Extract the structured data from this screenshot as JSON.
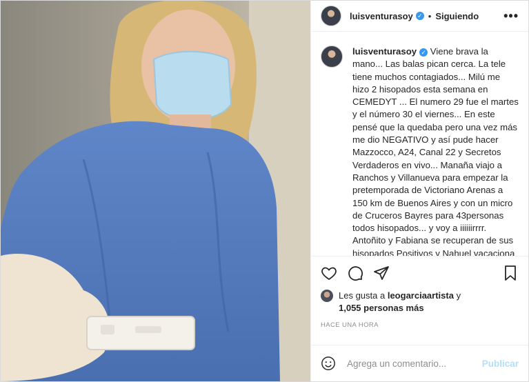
{
  "post": {
    "username": "luisventurasoy",
    "separator": "•",
    "follow_label": "Siguiendo",
    "more_label": "•••",
    "caption": "Viene brava la mano... Las balas pican cerca. La tele tiene muchos contagiados... Milú me hizo 2 hisopados esta semana en CEMEDYT ... El numero 29 fue el martes y el número 30 el viernes... En este pensé que la quedaba pero una vez más me dio NEGATIVO y así pude hacer Mazzocco, A24, Canal 22 y Secretos Verdaderos en vivo... Manaña viajo a Ranchos y Villanueva para empezar la pretemporada de Victoriano Arenas a 150 km de Buenos Aires y con un micro de Cruceros Bayres para 43personas todos hisopados... y voy a iiiiiirrrr. Antoñito y Fabiana se recuperan de sus hisopados Positivos y Nahuel vacaciona con su familia en Los Titanes. Tomo"
  },
  "likes": {
    "prefix": "Les gusta a",
    "liker": "leogarciaartista",
    "connector": "y",
    "others": "1,055 personas más"
  },
  "timestamp": "HACE UNA HORA",
  "comment": {
    "placeholder": "Agrega un comentario...",
    "publish_label": "Publicar"
  },
  "icons": {
    "heart": "heart-icon",
    "comment": "comment-icon",
    "share": "paper-plane-icon",
    "save": "bookmark-icon",
    "emoji": "emoji-icon",
    "verified": "verified-badge-icon"
  },
  "colors": {
    "verified": "#3897f0",
    "publish_disabled": "#b2dffc",
    "muted": "#8e8e8e"
  }
}
